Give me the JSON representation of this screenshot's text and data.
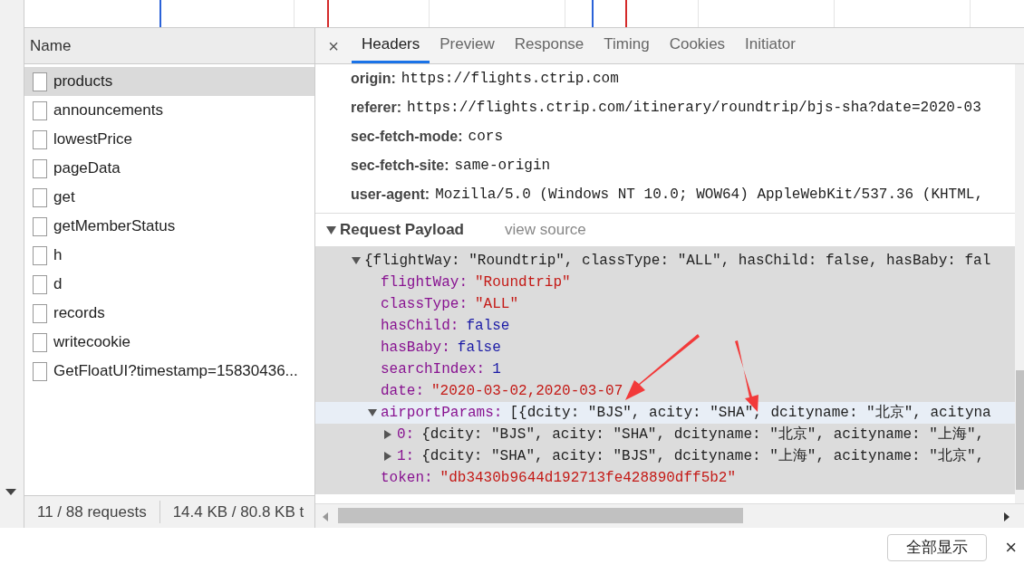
{
  "requests": [
    {
      "name": "products",
      "selected": true
    },
    {
      "name": "announcements",
      "selected": false
    },
    {
      "name": "lowestPrice",
      "selected": false
    },
    {
      "name": "pageData",
      "selected": false
    },
    {
      "name": "get",
      "selected": false
    },
    {
      "name": "getMemberStatus",
      "selected": false
    },
    {
      "name": "h",
      "selected": false
    },
    {
      "name": "d",
      "selected": false
    },
    {
      "name": "records",
      "selected": false
    },
    {
      "name": "writecookie",
      "selected": false
    },
    {
      "name": "GetFloatUI?timestamp=15830436...",
      "selected": false
    }
  ],
  "name_column": "Name",
  "status_bar": [
    "11 / 88 requests",
    "14.4 KB / 80.8 KB t"
  ],
  "detail_close": "×",
  "detail_tabs": [
    {
      "label": "Headers",
      "selected": true
    },
    {
      "label": "Preview",
      "selected": false
    },
    {
      "label": "Response",
      "selected": false
    },
    {
      "label": "Timing",
      "selected": false
    },
    {
      "label": "Cookies",
      "selected": false
    },
    {
      "label": "Initiator",
      "selected": false
    }
  ],
  "headers": [
    {
      "name": "origin:",
      "value": "https://flights.ctrip.com"
    },
    {
      "name": "referer:",
      "value": "https://flights.ctrip.com/itinerary/roundtrip/bjs-sha?date=2020-03"
    },
    {
      "name": "sec-fetch-mode:",
      "value": "cors"
    },
    {
      "name": "sec-fetch-site:",
      "value": "same-origin"
    },
    {
      "name": "user-agent:",
      "value": "Mozilla/5.0 (Windows NT 10.0; WOW64) AppleWebKit/537.36 (KHTML,"
    }
  ],
  "payload": {
    "title": "Request Payload",
    "expanded": true,
    "view_source": "view source",
    "tree": [
      {
        "preview": "{flightWay: \"Roundtrip\", classType: \"ALL\", hasChild: false, hasBaby: fal",
        "expanded": true,
        "highlighted": false,
        "children": [
          {
            "key": "flightWay:",
            "value": "\"Roundtrip\"",
            "kind": "string",
            "highlighted": false
          },
          {
            "key": "classType:",
            "value": "\"ALL\"",
            "kind": "string",
            "highlighted": false
          },
          {
            "key": "hasChild:",
            "value": "false",
            "kind": "literal",
            "highlighted": false
          },
          {
            "key": "hasBaby:",
            "value": "false",
            "kind": "literal",
            "highlighted": false
          },
          {
            "key": "searchIndex:",
            "value": "1",
            "kind": "literal",
            "highlighted": false
          },
          {
            "key": "date:",
            "value": "\"2020-03-02,2020-03-07",
            "kind": "string",
            "highlighted": false
          },
          {
            "key": "airportParams:",
            "preview": "[{dcity: \"BJS\", acity: \"SHA\", dcityname: \"北京\", acityna",
            "kind": "object",
            "expanded": true,
            "highlighted": true,
            "children": [
              {
                "key": "0:",
                "preview": "{dcity: \"BJS\", acity: \"SHA\", dcityname: \"北京\", acityname: \"上海\",",
                "expanded": false,
                "highlighted": false
              },
              {
                "key": "1:",
                "preview": "{dcity: \"SHA\", acity: \"BJS\", dcityname: \"上海\", acityname: \"北京\",",
                "expanded": false,
                "highlighted": false
              }
            ]
          },
          {
            "key": "token:",
            "value": "\"db3430b9644d192713fe428890dff5b2\"",
            "kind": "string",
            "highlighted": false
          }
        ]
      }
    ]
  },
  "bottom_bar": {
    "button": "全部显示",
    "close": "×"
  }
}
